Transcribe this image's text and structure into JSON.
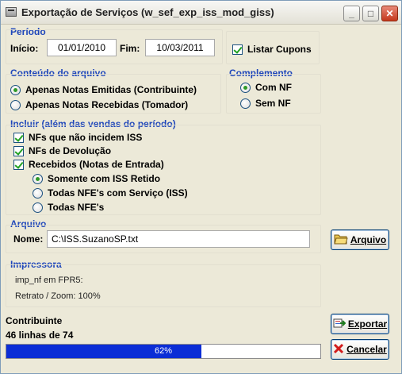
{
  "window": {
    "title": "Exportação de Serviços (w_sef_exp_iss_mod_giss)",
    "minimize_label": "_",
    "maximize_label": "□",
    "close_label": "✕"
  },
  "periodo": {
    "title": "Período",
    "inicio_label": "Início:",
    "inicio_value": "01/01/2010",
    "fim_label": "Fim:",
    "fim_value": "10/03/2011",
    "listar_cupons_label": "Listar Cupons",
    "listar_cupons_checked": true
  },
  "conteudo": {
    "title": "Conteúdo do arquivo",
    "options": [
      {
        "label": "Apenas Notas Emitidas (Contribuinte)",
        "selected": true
      },
      {
        "label": "Apenas Notas Recebidas (Tomador)",
        "selected": false
      }
    ]
  },
  "complemento": {
    "title": "Complemento",
    "options": [
      {
        "label": "Com NF",
        "selected": true
      },
      {
        "label": "Sem NF",
        "selected": false
      }
    ]
  },
  "incluir": {
    "title": "Incluir (além das vendas do período)",
    "checks": [
      {
        "label": "NFs que não incidem ISS",
        "checked": true
      },
      {
        "label": "NFs de Devolução",
        "checked": true
      },
      {
        "label": "Recebidos (Notas de Entrada)",
        "checked": true
      }
    ],
    "radios": [
      {
        "label": "Somente com ISS Retido",
        "selected": true
      },
      {
        "label": "Todas NFE's com Serviço (ISS)",
        "selected": false
      },
      {
        "label": "Todas NFE's",
        "selected": false
      }
    ]
  },
  "arquivo": {
    "title": "Arquivo",
    "nome_label": "Nome:",
    "nome_value": "C:\\ISS.SuzanoSP.txt",
    "button_label": "Arquivo",
    "button_icon": "folder-open-icon"
  },
  "impressora": {
    "title": "Impressora",
    "line1": "imp_nf em FPR5:",
    "line2": "Retrato / Zoom: 100%"
  },
  "status": {
    "heading": "Contribuinte",
    "lines": "46 linhas de 74",
    "progress_percent": 62,
    "progress_text": "62%"
  },
  "actions": {
    "export_label": "Exportar",
    "export_icon": "export-icon",
    "cancel_label": "Cancelar",
    "cancel_icon": "cancel-x-icon"
  },
  "colors": {
    "group_title": "#1e46ba",
    "progress_fill": "#0b2dd6",
    "window_bg": "#ece9d8"
  }
}
